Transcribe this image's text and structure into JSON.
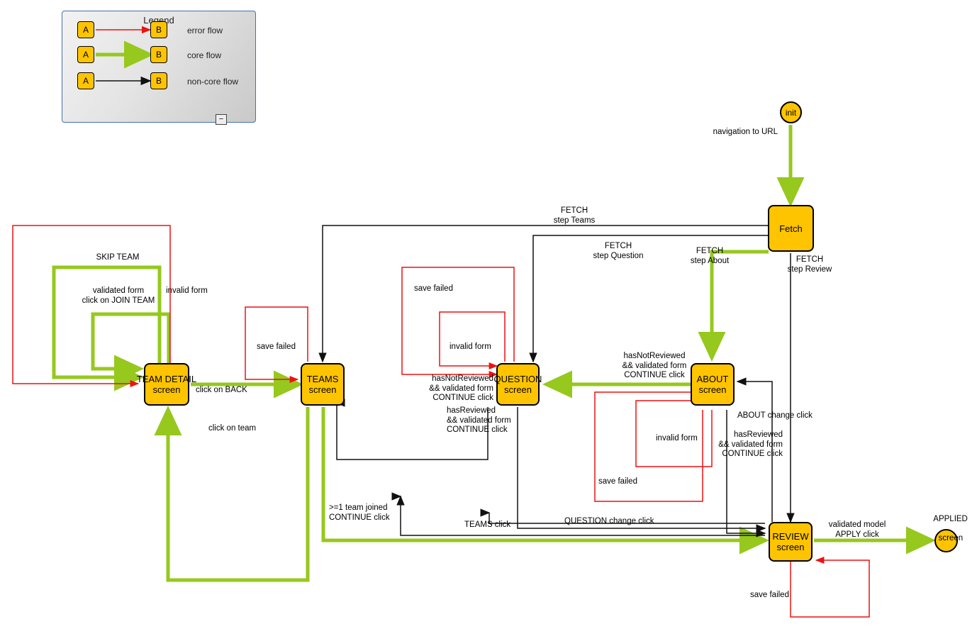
{
  "legend": {
    "title": "Legend",
    "rows": [
      {
        "from": "A",
        "to": "B",
        "label": "error flow",
        "color": "#ee1111"
      },
      {
        "from": "A",
        "to": "B",
        "label": "core flow",
        "color": "#96c81e"
      },
      {
        "from": "A",
        "to": "B",
        "label": "non-core flow",
        "color": "#111111"
      }
    ],
    "collapse_glyph": "−"
  },
  "colors": {
    "node_fill": "#FFC400",
    "node_stroke": "#000000",
    "error_flow": "#ee1111",
    "core_flow": "#96c81e",
    "non_core_flow": "#000000",
    "legend_border": "#4472a8"
  },
  "nodes": [
    {
      "id": "init",
      "line1": "init",
      "line2": "",
      "shape": "circle"
    },
    {
      "id": "fetch",
      "line1": "Fetch",
      "line2": "",
      "shape": "box"
    },
    {
      "id": "team-detail",
      "line1": "TEAM DETAIL",
      "line2": "screen",
      "shape": "box"
    },
    {
      "id": "teams",
      "line1": "TEAMS",
      "line2": "screen",
      "shape": "box"
    },
    {
      "id": "question",
      "line1": "QUESTION",
      "line2": "screen",
      "shape": "box"
    },
    {
      "id": "about",
      "line1": "ABOUT",
      "line2": "screen",
      "shape": "box"
    },
    {
      "id": "review",
      "line1": "REVIEW",
      "line2": "screen",
      "shape": "box"
    },
    {
      "id": "applied",
      "line1": "APPLIED",
      "line2": "screen",
      "shape": "circle"
    }
  ],
  "edges": [
    {
      "id": "init-fetch",
      "label": "navigation to URL",
      "flow": "core"
    },
    {
      "id": "fetch-teams",
      "label": "FETCH\nstep Teams",
      "flow": "non-core"
    },
    {
      "id": "fetch-question",
      "label": "FETCH\nstep Question",
      "flow": "non-core"
    },
    {
      "id": "fetch-about",
      "label": "FETCH\nstep About",
      "flow": "core"
    },
    {
      "id": "fetch-review",
      "label": "FETCH\nstep Review",
      "flow": "non-core"
    },
    {
      "id": "teamdetail-invalid",
      "label": "invalid form",
      "flow": "error"
    },
    {
      "id": "teamdetail-skip",
      "label": "SKIP TEAM",
      "flow": "core"
    },
    {
      "id": "teamdetail-join",
      "label": "validated form\nclick on JOIN TEAM",
      "flow": "core"
    },
    {
      "id": "teamdetail-teams",
      "label": "click on BACK",
      "flow": "core"
    },
    {
      "id": "teams-teamdetail",
      "label": "click on team",
      "flow": "core"
    },
    {
      "id": "teams-savefailed",
      "label": "save failed",
      "flow": "error"
    },
    {
      "id": "teams-review",
      "label": ">=1 team joined\nCONTINUE click",
      "flow": "core"
    },
    {
      "id": "question-savefailed",
      "label": "save failed",
      "flow": "error"
    },
    {
      "id": "question-invalid",
      "label": "invalid form",
      "flow": "error"
    },
    {
      "id": "question-teams",
      "label": "hasNotReviewed\n&& validated form\nCONTINUE click",
      "flow": "non-core"
    },
    {
      "id": "about-question",
      "label": "hasNotReviewed\n&& validated form\nCONTINUE click",
      "flow": "core"
    },
    {
      "id": "question-review",
      "label": "hasReviewed\n&& validated form\nCONTINUE click",
      "flow": "non-core"
    },
    {
      "id": "about-review",
      "label": "hasReviewed\n&& validated form\nCONTINUE click",
      "flow": "non-core"
    },
    {
      "id": "about-invalid",
      "label": "invalid form",
      "flow": "error"
    },
    {
      "id": "about-savefailed",
      "label": "save failed",
      "flow": "error"
    },
    {
      "id": "review-about",
      "label": "ABOUT change click",
      "flow": "non-core"
    },
    {
      "id": "review-question",
      "label": "QUESTION change click",
      "flow": "non-core"
    },
    {
      "id": "review-teams",
      "label": "TEAMS click",
      "flow": "non-core"
    },
    {
      "id": "review-savefailed",
      "label": "save failed",
      "flow": "error"
    },
    {
      "id": "review-applied",
      "label": "validated model\nAPPLY click",
      "flow": "core"
    }
  ]
}
